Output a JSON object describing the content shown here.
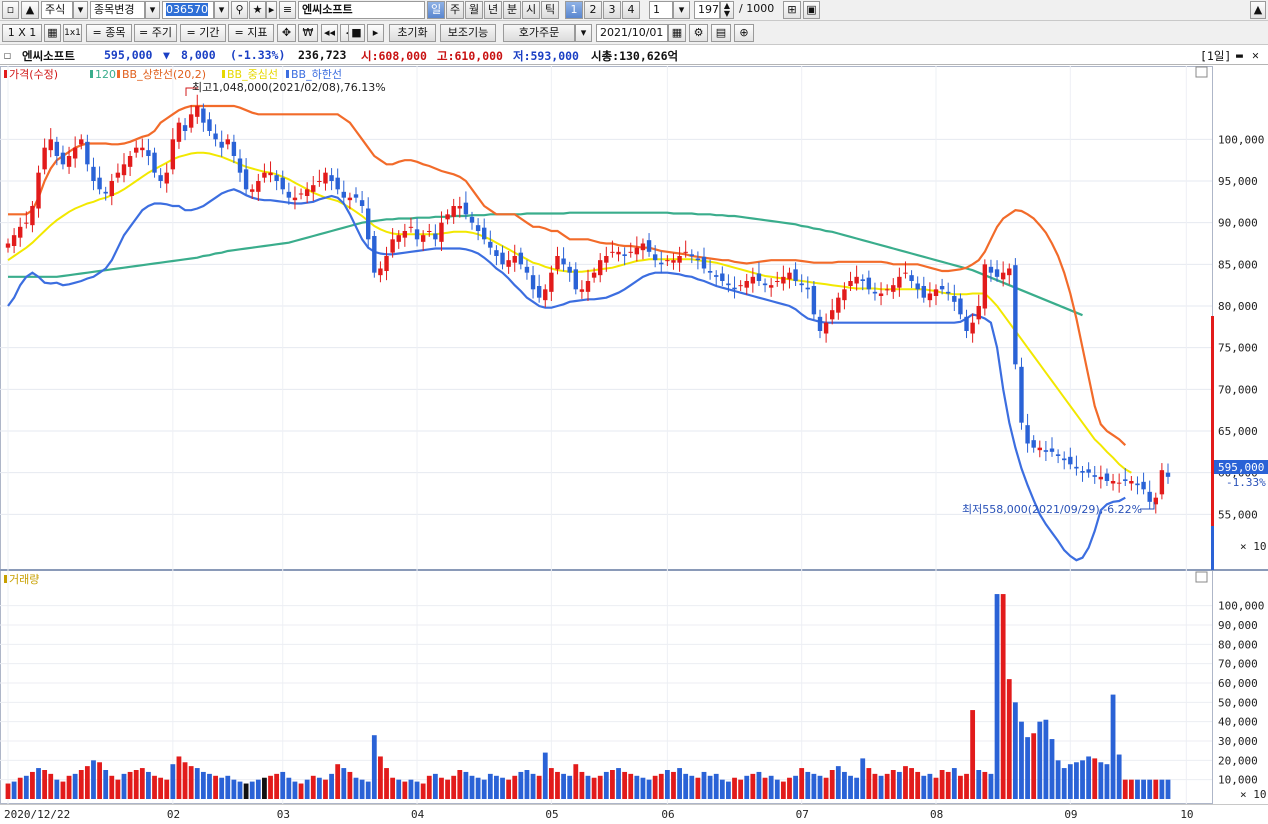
{
  "toolbar1": {
    "market": "주식",
    "change_stock": "종목변경",
    "code": "036570",
    "name": "엔씨소프트",
    "periods": [
      "일",
      "주",
      "월",
      "년",
      "분",
      "시",
      "틱"
    ],
    "active_period": "일",
    "tick_nums": [
      "1",
      "2",
      "3",
      "4"
    ],
    "interval_value": "1",
    "count": "197",
    "max_count": "/ 1000"
  },
  "toolbar2": {
    "grid_label": "1 X 1",
    "item_label": "= 종목",
    "cycle_label": "= 주기",
    "period_label": "= 기간",
    "indicator_label": "= 지표",
    "reset_label": "초기화",
    "aux_label": "보조기능",
    "quote_label": "호가주문",
    "date": "2021/10/01"
  },
  "info": {
    "name": "엔씨소프트",
    "price": "595,000",
    "change_arrow": "▼",
    "change": "8,000",
    "change_pct": "(-1.33%)",
    "volume": "236,723",
    "open": "시:608,000",
    "high": "고:610,000",
    "low": "저:593,000",
    "mcap": "시총:130,626억",
    "period_tag": "[1일]"
  },
  "colors": {
    "up": "#e21b1b",
    "down": "#2a62d6",
    "bb_upper": "#f26b2a",
    "bb_mid": "#f2e800",
    "bb_lower": "#3c6ee0",
    "ma120": "#3aad8c",
    "volume_label": "#c8a000"
  },
  "legend": {
    "price": "가격(수정)",
    "ma": "120",
    "bb_upper": "BB_상한선(20,2)",
    "bb_mid": "BB_중심선",
    "bb_lower": "BB_하한선",
    "volume": "거래량"
  },
  "annotations": {
    "high": "최고1,048,000(2021/02/08),76.13%",
    "low": "최저558,000(2021/09/29),-6.22%"
  },
  "current_price_tag": "595,000",
  "current_pct_tag": "-1.33%",
  "price_axis_unit": "× 10",
  "volume_axis_unit": "× 10",
  "chart_data": {
    "type": "candlestick",
    "price_axis": {
      "ticks": [
        100000,
        95000,
        90000,
        85000,
        80000,
        75000,
        70000,
        65000,
        60000,
        55000
      ],
      "tick_labels": [
        "100,000",
        "95,000",
        "90,000",
        "85,000",
        "80,000",
        "75,000",
        "70,000",
        "65,000",
        "60,000",
        "55,000"
      ],
      "range": [
        48000,
        108000
      ]
    },
    "volume_axis": {
      "ticks": [
        100000,
        90000,
        80000,
        70000,
        60000,
        50000,
        40000,
        30000,
        20000,
        10000
      ],
      "tick_labels": [
        "100,000",
        "90,000",
        "80,000",
        "70,000",
        "60,000",
        "50,000",
        "40,000",
        "30,000",
        "20,000",
        "10,000"
      ],
      "range": [
        0,
        110000
      ]
    },
    "x_labels": [
      {
        "label": "2020/12/22",
        "i": 0
      },
      {
        "label": "02",
        "i": 27
      },
      {
        "label": "03",
        "i": 45
      },
      {
        "label": "04",
        "i": 67
      },
      {
        "label": "05",
        "i": 89
      },
      {
        "label": "06",
        "i": 108
      },
      {
        "label": "07",
        "i": 130
      },
      {
        "label": "08",
        "i": 152
      },
      {
        "label": "09",
        "i": 174
      },
      {
        "label": "10",
        "i": 193
      }
    ],
    "closes": [
      87.5,
      88.5,
      89.5,
      90,
      92,
      96,
      99,
      100,
      98,
      97,
      98,
      99,
      100,
      97,
      95,
      94,
      93.5,
      95,
      96,
      97,
      98,
      99,
      99,
      98,
      96,
      95,
      96,
      100,
      102,
      101,
      103,
      104,
      102,
      101,
      100,
      99,
      100,
      98,
      96,
      94,
      94,
      95,
      96,
      96,
      95,
      94,
      93,
      93,
      93.5,
      94,
      94.5,
      95,
      96,
      95,
      94,
      93,
      93,
      93,
      92,
      88,
      84,
      84.5,
      86,
      88,
      88.5,
      89,
      89.5,
      88,
      88.5,
      89,
      88,
      90,
      91,
      92,
      92,
      91,
      90,
      89,
      88,
      87,
      86,
      85,
      85.5,
      86,
      85,
      84,
      82,
      81,
      82,
      84,
      86,
      85,
      84,
      82,
      82,
      83,
      84,
      85.5,
      86,
      86.5,
      86.5,
      86,
      86.5,
      87,
      87.5,
      86.5,
      85.5,
      85,
      85.5,
      85.5,
      86,
      86.5,
      86,
      85.5,
      84.5,
      84,
      83.5,
      83,
      82.5,
      82,
      82.5,
      83,
      83.5,
      83,
      82.5,
      82.5,
      83,
      83.5,
      84,
      83,
      82.5,
      82,
      79,
      77,
      78,
      79.5,
      81,
      82,
      83,
      83.5,
      83,
      82,
      81.5,
      81.5,
      82,
      82.5,
      83.5,
      84,
      83,
      82,
      81,
      81.5,
      82,
      82,
      81.5,
      80.5,
      79,
      77,
      78,
      80,
      85,
      84,
      83.5,
      84,
      84.5,
      73,
      66,
      63.5,
      63,
      63,
      62.5,
      62.5,
      62,
      61.5,
      61,
      60.5,
      60,
      60,
      59.5,
      59.5,
      59,
      59,
      58.8,
      59,
      59,
      58.5,
      58,
      56.5,
      57,
      60.3,
      59.5
    ],
    "opens_note": "",
    "bb_upper": [
      91,
      91,
      91,
      91,
      91.5,
      93,
      95,
      96.5,
      97.5,
      98,
      98.5,
      99,
      99.3,
      99.5,
      99.5,
      99.5,
      99.5,
      99.4,
      99.4,
      99.5,
      99.7,
      100,
      100.3,
      100.5,
      101,
      102,
      102.5,
      103,
      103.5,
      103.8,
      104,
      104,
      104,
      104,
      104,
      104,
      104,
      104,
      103.8,
      103.5,
      103.2,
      103,
      103,
      103,
      103,
      103,
      103,
      103,
      103,
      103,
      103,
      103,
      103,
      103,
      103,
      102.5,
      102,
      101,
      100,
      99,
      98,
      97.5,
      97,
      97,
      97.3,
      97.5,
      97.5,
      97.3,
      97,
      96.8,
      96.5,
      96.2,
      96,
      95.8,
      95.5,
      95,
      94,
      93,
      92,
      91.5,
      91,
      91,
      91,
      91,
      90.5,
      90,
      89.5,
      89.5,
      89.3,
      89,
      89,
      88.5,
      88,
      88,
      88,
      88,
      87.8,
      87.6,
      87.5,
      87.5,
      87.3,
      87.2,
      87.2,
      87.1,
      87,
      87,
      86.8,
      86.6,
      86.5,
      86.4,
      86.3,
      86.2,
      86,
      85.9,
      85.8,
      85.7,
      85.6,
      85.5,
      85.5,
      85.3,
      85.2,
      85.1,
      85.2,
      85.3,
      85.4,
      85.5,
      85.5,
      85.5,
      85.5,
      85.5,
      85.4,
      85.3,
      85.2,
      85.2,
      85.2,
      85.2,
      85.3,
      85.3,
      85.3,
      85.3,
      85.3,
      85.3,
      85.3,
      85.3,
      85.2,
      85,
      85,
      85,
      85,
      85,
      84.8,
      84.6,
      84.4,
      84.2,
      84.2,
      84.3,
      84.4,
      84.6,
      85,
      85.5,
      86.5,
      88,
      89.5,
      90.5,
      91,
      91.5,
      91.4,
      91,
      90.5,
      89.7,
      88.8,
      87.5,
      86,
      84,
      81.5,
      78.5,
      75,
      71.5,
      68,
      65.8,
      65,
      64.5,
      64,
      63.3
    ],
    "bb_mid": [
      85.5,
      86,
      86.5,
      87,
      87.6,
      88.3,
      89,
      89.7,
      90.3,
      90.8,
      91.3,
      91.7,
      92,
      92.3,
      92.5,
      92.8,
      93,
      93.3,
      93.6,
      94,
      94.5,
      95,
      95.5,
      96,
      96.4,
      96.8,
      97.2,
      97.6,
      97.9,
      98.1,
      98.3,
      98.4,
      98.4,
      98.3,
      98.1,
      97.9,
      97.6,
      97.3,
      97,
      96.7,
      96.5,
      96.3,
      96.1,
      96,
      95.8,
      95.5,
      95.2,
      94.8,
      94.4,
      94,
      93.6,
      93.3,
      93,
      92.8,
      92.6,
      92.2,
      91.8,
      91.3,
      90.8,
      90.2,
      89.6,
      89.2,
      88.9,
      88.7,
      88.6,
      88.6,
      88.6,
      88.6,
      88.6,
      88.6,
      88.6,
      88.7,
      88.8,
      88.9,
      88.9,
      88.9,
      88.8,
      88.6,
      88.3,
      88,
      87.6,
      87.2,
      86.8,
      86.4,
      86,
      85.6,
      85.2,
      85,
      84.7,
      84.5,
      84.3,
      84.2,
      84.1,
      84.1,
      84.1,
      84.2,
      84.3,
      84.4,
      84.5,
      84.6,
      84.8,
      85,
      85.2,
      85.4,
      85.5,
      85.6,
      85.6,
      85.6,
      85.6,
      85.6,
      85.6,
      85.6,
      85.6,
      85.5,
      85.4,
      85.3,
      85.2,
      85,
      84.8,
      84.6,
      84.4,
      84.2,
      84,
      83.8,
      83.6,
      83.5,
      83.4,
      83.3,
      83.2,
      83.1,
      83,
      82.9,
      82.8,
      82.7,
      82.6,
      82.5,
      82.4,
      82.3,
      82.2,
      82.1,
      82.1,
      82.1,
      82.1,
      82,
      82,
      82,
      82,
      82,
      82,
      82,
      82,
      81.9,
      81.8,
      81.6,
      81.5,
      81.4,
      81.4,
      81.4,
      81.5,
      81.5,
      81.5,
      80.8,
      80,
      79,
      78,
      77,
      76,
      75,
      74,
      73,
      72,
      71,
      70,
      69,
      68,
      67,
      66,
      65,
      64,
      63.3,
      62.5,
      61.8,
      61,
      60.4,
      60
    ],
    "bb_lower": [
      80,
      81,
      82.5,
      83.5,
      84,
      83.5,
      82.8,
      82.7,
      82.8,
      82.5,
      82.6,
      82.8,
      83,
      83.3,
      83.5,
      84,
      84.5,
      85.5,
      87,
      88.5,
      89.5,
      90.5,
      91.5,
      92,
      92.3,
      92.3,
      92.2,
      92,
      92,
      91.5,
      91.5,
      91.7,
      92,
      92.5,
      93,
      93.5,
      93.8,
      94,
      93.7,
      93.3,
      93,
      92.8,
      92.7,
      92.7,
      92.6,
      92.5,
      92.4,
      92.3,
      92.3,
      92.4,
      92.5,
      92.8,
      93,
      93.2,
      93,
      92.3,
      91,
      89.5,
      88,
      87,
      86.5,
      86.3,
      86.2,
      86.2,
      86.3,
      86.4,
      86.5,
      86.6,
      86.7,
      86.8,
      86.9,
      86.9,
      86.9,
      86.9,
      86.9,
      86.8,
      86.6,
      86.3,
      85.8,
      85.2,
      84.5,
      84,
      83.3,
      82.5,
      81.8,
      81,
      80.5,
      80,
      79.8,
      79.8,
      80,
      80.2,
      80.5,
      80.6,
      80.7,
      80.8,
      80.8,
      80.9,
      81,
      81.3,
      81.6,
      82,
      82.5,
      83,
      83.5,
      83.8,
      84,
      84,
      84,
      83.9,
      83.8,
      83.6,
      83.5,
      83.2,
      83,
      82.7,
      82.4,
      82.2,
      82,
      81.8,
      81.6,
      81.4,
      81.2,
      81,
      80.8,
      80.6,
      80.4,
      80.2,
      80,
      79.6,
      79,
      78.5,
      78.3,
      78.1,
      78,
      78,
      78,
      78,
      78,
      78,
      78,
      78,
      78,
      78,
      78,
      78,
      78,
      78,
      78,
      78,
      78,
      78,
      78,
      78,
      78,
      78,
      78.1,
      78.5,
      79,
      78.8,
      78.5,
      78,
      75,
      70,
      66,
      63,
      60.5,
      58.5,
      56.7,
      55,
      53.8,
      52.8,
      51.8,
      50.7,
      50,
      49.5,
      49.8,
      51,
      53,
      55.5,
      56.2,
      56.5,
      56.6,
      57
    ],
    "ma120": [
      83.5,
      83.5,
      83.5,
      83.5,
      83.5,
      83.5,
      83.5,
      83.5,
      83.5,
      83.6,
      83.7,
      83.8,
      83.9,
      84,
      84.1,
      84.2,
      84.3,
      84.4,
      84.5,
      84.6,
      84.7,
      84.8,
      84.9,
      85,
      85.1,
      85.2,
      85.3,
      85.4,
      85.5,
      85.6,
      85.7,
      85.8,
      86,
      86.1,
      86.3,
      86.4,
      86.6,
      86.7,
      86.8,
      86.9,
      87,
      87.1,
      87.2,
      87.3,
      87.4,
      87.5,
      87.6,
      87.8,
      88,
      88.2,
      88.4,
      88.6,
      88.8,
      89,
      89.2,
      89.4,
      89.6,
      89.8,
      90,
      90.1,
      90.2,
      90.3,
      90.4,
      90.4,
      90.5,
      90.5,
      90.5,
      90.6,
      90.6,
      90.6,
      90.7,
      90.7,
      90.7,
      90.8,
      90.8,
      90.8,
      90.9,
      90.9,
      90.9,
      91,
      91,
      91,
      91,
      91,
      91,
      91.1,
      91.1,
      91.1,
      91.1,
      91.1,
      91.1,
      91.1,
      91.2,
      91.2,
      91.2,
      91.2,
      91.2,
      91.2,
      91.2,
      91.2,
      91.2,
      91.2,
      91.2,
      91.2,
      91.2,
      91.2,
      91.2,
      91.2,
      91.2,
      91.1,
      91.1,
      91.1,
      91.1,
      91,
      91,
      91,
      90.9,
      90.9,
      90.8,
      90.8,
      90.7,
      90.6,
      90.5,
      90.4,
      90.3,
      90.2,
      90.1,
      90,
      89.9,
      89.8,
      89.6,
      89.5,
      89.3,
      89.2,
      89,
      88.9,
      88.7,
      88.5,
      88.3,
      88.1,
      87.9,
      87.7,
      87.5,
      87.3,
      87.1,
      86.9,
      86.7,
      86.5,
      86.3,
      86.1,
      85.9,
      85.7,
      85.5,
      85.3,
      85.1,
      84.9,
      84.7,
      84.5,
      84.3,
      84,
      83.7,
      83.4,
      83.1,
      82.8,
      82.5,
      82.2,
      81.9,
      81.6,
      81.3,
      81,
      80.7,
      80.4,
      80.1,
      79.8,
      79.5,
      79.2,
      78.9
    ],
    "volumes": [
      8,
      9,
      11,
      12,
      14,
      16,
      15,
      13,
      10,
      9,
      12,
      13,
      15,
      17,
      20,
      19,
      15,
      12,
      10,
      13,
      14,
      15,
      16,
      14,
      12,
      11,
      10,
      18,
      22,
      19,
      17,
      16,
      14,
      13,
      12,
      11,
      12,
      10,
      9,
      8,
      9,
      10,
      11,
      12,
      13,
      14,
      11,
      9,
      8,
      10,
      12,
      11,
      10,
      13,
      18,
      16,
      14,
      11,
      10,
      9,
      33,
      22,
      16,
      11,
      10,
      9,
      10,
      9,
      8,
      12,
      13,
      11,
      10,
      12,
      15,
      14,
      12,
      11,
      10,
      13,
      12,
      11,
      10,
      12,
      14,
      15,
      13,
      12,
      24,
      16,
      14,
      13,
      12,
      18,
      14,
      12,
      11,
      12,
      14,
      15,
      16,
      14,
      13,
      12,
      11,
      10,
      12,
      13,
      15,
      14,
      16,
      13,
      12,
      11,
      14,
      12,
      13,
      10,
      9,
      11,
      10,
      12,
      13,
      14,
      11,
      12,
      10,
      9,
      11,
      12,
      16,
      14,
      13,
      12,
      11,
      15,
      17,
      14,
      12,
      11,
      21,
      16,
      13,
      12,
      13,
      15,
      14,
      17,
      16,
      14,
      12,
      13,
      11,
      15,
      14,
      16,
      12,
      13,
      46,
      15,
      14,
      13,
      106,
      106,
      62,
      50,
      40,
      32,
      34,
      40,
      41,
      31,
      20,
      16,
      18,
      19,
      20,
      22,
      21,
      19,
      18,
      54,
      23
    ],
    "volume_up": [
      1,
      0,
      1,
      0,
      1,
      0,
      1,
      1,
      0,
      1,
      1,
      0,
      1,
      1,
      0,
      1,
      0,
      1,
      1,
      0,
      1,
      1,
      1,
      0,
      1,
      1,
      1,
      0,
      1,
      1,
      1,
      0,
      0,
      0,
      1,
      0,
      0,
      0,
      0,
      2,
      0,
      0,
      2,
      1,
      1,
      0,
      0,
      0,
      1,
      0,
      1,
      0,
      1,
      0,
      1,
      0,
      1,
      0,
      0,
      0,
      0,
      1,
      1,
      1,
      0,
      1,
      0,
      0,
      1,
      1,
      0,
      1,
      1,
      1,
      1,
      0,
      0,
      0,
      0,
      0,
      0,
      0,
      1,
      1,
      0,
      0,
      0,
      1,
      0,
      1,
      1,
      0,
      0,
      1,
      1,
      0,
      1,
      1,
      0,
      1,
      0,
      1,
      1,
      0,
      0,
      0,
      1,
      1,
      0,
      1,
      0,
      0,
      0,
      1,
      0,
      0,
      0,
      0,
      0,
      1,
      1,
      0,
      1,
      0,
      1,
      0,
      0,
      1,
      1,
      0,
      1,
      0,
      0,
      0,
      1,
      1,
      0,
      0,
      0,
      0,
      0,
      1,
      1,
      0,
      1,
      1,
      0,
      1,
      1,
      1,
      0,
      0,
      1,
      1,
      1,
      0,
      1,
      1,
      1,
      0,
      1,
      0,
      0,
      1,
      1,
      0,
      0,
      0,
      1,
      0,
      0,
      0,
      0,
      0,
      0,
      0,
      0,
      0,
      1,
      0,
      0,
      0,
      0,
      1,
      1,
      0,
      0,
      0,
      1
    ]
  }
}
